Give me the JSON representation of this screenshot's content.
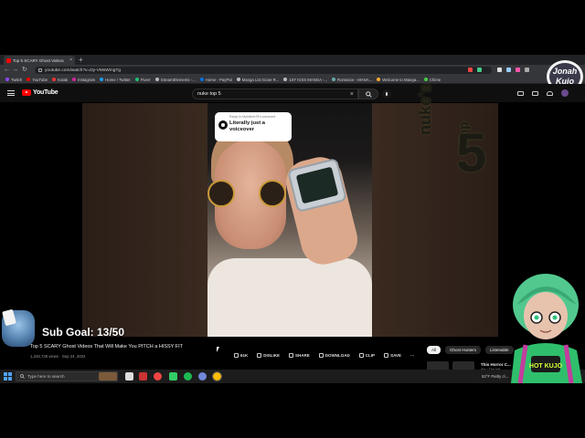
{
  "browser": {
    "tab_title": "Top 5 SCARY Ghost Videos",
    "url": "youtube.com/watch?v=Dy-VMsWmgTg",
    "bookmarks": [
      {
        "label": "Twitch",
        "color": "#9146ff"
      },
      {
        "label": "YouTube",
        "color": "#ff0000"
      },
      {
        "label": "Kotak",
        "color": "#e33"
      },
      {
        "label": "Instagram",
        "color": "#d6249f"
      },
      {
        "label": "Home / Twitter",
        "color": "#1d9bf0"
      },
      {
        "label": "Fiverr",
        "color": "#1dbf73"
      },
      {
        "label": "StreamElements -...",
        "color": "#bbb"
      },
      {
        "label": "Home - PayPal",
        "color": "#0070e0"
      },
      {
        "label": "Manga List Gone R...",
        "color": "#bbb"
      },
      {
        "label": "1ST KISS MANGA -...",
        "color": "#bbb"
      },
      {
        "label": "Romance - MANA...",
        "color": "#6aa"
      },
      {
        "label": "Welcome to Manga...",
        "color": "#fa3"
      },
      {
        "label": "Chime",
        "color": "#4c4"
      }
    ]
  },
  "youtube": {
    "logo_text": "YouTube",
    "search_value": "nuke top 5"
  },
  "video": {
    "comment_reply": "Reply to MyNtbrrr75's comment",
    "comment_text": "Literally just a voiceover",
    "overlay_word": "nuke's",
    "overlay_top": "Top",
    "overlay_num": "5",
    "title": "Top 5 SCARY Ghost Videos That Will Make You PITCH a HISSY FIT",
    "meta": "1,228,728 views · Sep 24, 2022"
  },
  "actions": {
    "likes": "61K",
    "dislike": "DISLIKE",
    "share": "SHARE",
    "download": "DOWNLOAD",
    "clip": "CLIP",
    "save": "SAVE",
    "more": "···"
  },
  "chips": [
    "All",
    "Ghost Hunters",
    "Listenable"
  ],
  "recommended": {
    "title": "This Horror C...",
    "sub": "Ale / The Infi..."
  },
  "stream": {
    "sub_goal": "Sub Goal: 13/50",
    "logo_text": "Jonah Kujo",
    "vtuber_shirt": "HOT KUJO"
  },
  "taskbar": {
    "search_placeholder": "Type here to search",
    "weather": "53°F  Partly cl..."
  }
}
